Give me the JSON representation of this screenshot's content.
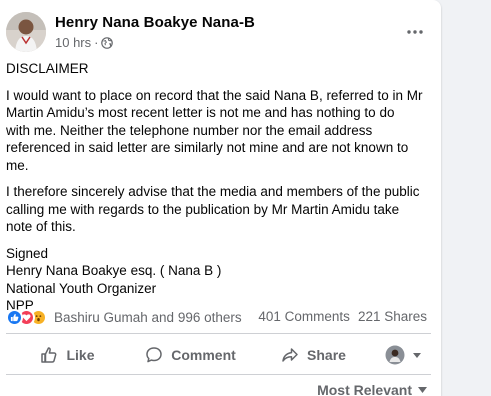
{
  "post": {
    "author": "Henry Nana Boakye Nana-B",
    "time": "10 hrs",
    "separator": "·",
    "audience_icon": "globe-icon",
    "more_icon": "more-options-icon",
    "paragraphs": [
      [
        "DISCLAIMER"
      ],
      [
        "I would want to place on record that the said Nana B, referred to in Mr",
        "Martin Amidu’s most recent letter is not me and has nothing to do",
        "with me.  Neither the telephone number nor the email address",
        "referenced in said letter are similarly not mine and are not known to",
        "me."
      ],
      [
        "I therefore sincerely advise that the media and members of the public",
        "calling me with regards to the publication by Mr Martin Amidu take",
        "note of this."
      ],
      [
        "Signed",
        "Henry Nana Boakye esq. ( Nana B )",
        "National Youth Organizer",
        "NPP"
      ]
    ]
  },
  "stats": {
    "reactors": "Bashiru Gumah and 996 others",
    "comments": "401 Comments",
    "shares": "221 Shares",
    "reaction_icons": [
      "like-reaction-icon",
      "love-reaction-icon",
      "wow-reaction-icon"
    ]
  },
  "actions": {
    "like": "Like",
    "comment": "Comment",
    "share": "Share"
  },
  "comments_sort": {
    "label": "Most Relevant"
  },
  "colors": {
    "accent": "#1877f2",
    "love": "#f33e58",
    "wow": "#f7b125",
    "secondary_text": "#65676b"
  }
}
